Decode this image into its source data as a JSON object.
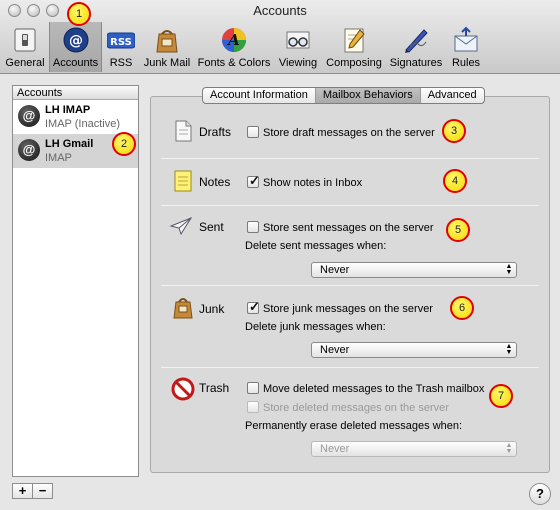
{
  "window": {
    "title": "Accounts"
  },
  "toolbar": {
    "items": [
      {
        "label": "General",
        "icon": "general-switch-icon"
      },
      {
        "label": "Accounts",
        "icon": "at-sign-icon"
      },
      {
        "label": "RSS",
        "icon": "rss-icon",
        "icon_text": "RSS"
      },
      {
        "label": "Junk Mail",
        "icon": "junk-mail-bag-icon"
      },
      {
        "label": "Fonts & Colors",
        "icon": "color-font-icon",
        "icon_text": "A"
      },
      {
        "label": "Viewing",
        "icon": "glasses-icon"
      },
      {
        "label": "Composing",
        "icon": "pencil-paper-icon"
      },
      {
        "label": "Signatures",
        "icon": "pen-signature-icon"
      },
      {
        "label": "Rules",
        "icon": "rules-envelope-icon"
      }
    ]
  },
  "accounts": {
    "header": "Accounts",
    "items": [
      {
        "name": "LH IMAP",
        "type": "IMAP (Inactive)",
        "avatar": "@"
      },
      {
        "name": "LH Gmail",
        "type": "IMAP",
        "avatar": "@"
      }
    ],
    "add_label": "+",
    "remove_label": "−"
  },
  "tabs": [
    "Account Information",
    "Mailbox Behaviors",
    "Advanced"
  ],
  "sections": {
    "drafts": {
      "title": "Drafts",
      "checkbox": "Store draft messages on the server"
    },
    "notes": {
      "title": "Notes",
      "checkbox": "Show notes in Inbox"
    },
    "sent": {
      "title": "Sent",
      "checkbox": "Store sent messages on the server",
      "delete_label": "Delete sent messages when:",
      "delete_value": "Never"
    },
    "junk": {
      "title": "Junk",
      "checkbox": "Store junk messages on the server",
      "delete_label": "Delete junk messages when:",
      "delete_value": "Never"
    },
    "trash": {
      "title": "Trash",
      "checkbox": "Move deleted messages to the Trash mailbox",
      "checkbox2": "Store deleted messages on the server",
      "delete_label": "Permanently erase deleted messages when:",
      "delete_value": "Never"
    }
  },
  "help": "?",
  "badges": [
    "1",
    "2",
    "3",
    "4",
    "5",
    "6",
    "7"
  ],
  "colors": {
    "badge_fill": "#f4d800",
    "badge_border": "#e00000",
    "selection": "#d4d4d4"
  }
}
